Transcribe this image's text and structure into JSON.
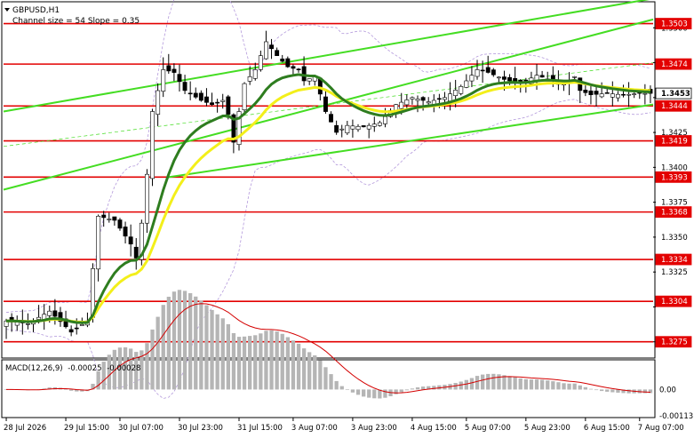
{
  "header": {
    "symbol": "GBPUSD,H1",
    "channel_info": "Channel size = 54 Slope = 0.35"
  },
  "chart_data": {
    "type": "candlestick",
    "symbol": "GBPUSD",
    "timeframe": "H1",
    "ylim": [
      1.3264,
      1.3518
    ],
    "current_price": 1.3453,
    "price_ticks": [
      1.3275,
      1.33,
      1.3325,
      1.335,
      1.3375,
      1.34,
      1.3425,
      1.345,
      1.3475,
      1.35
    ],
    "level_labels": [
      "1.3503",
      "1.3474",
      "1.3453",
      "1.3444",
      "1.3419",
      "1.3393",
      "1.3368",
      "1.3334",
      "1.3304",
      "1.3275"
    ],
    "hidden_tick_labels": [
      "1.3475",
      "1.3450",
      "1.3300",
      "1.3275"
    ],
    "time_labels": [
      "28 Jul 2026",
      "29 Jul 15:00",
      "30 Jul 07:00",
      "30 Jul 23:00",
      "31 Jul 15:00",
      "3 Aug 07:00",
      "3 Aug 23:00",
      "4 Aug 15:00",
      "5 Aug 07:00",
      "5 Aug 23:00",
      "6 Aug 15:00",
      "7 Aug 07:00"
    ],
    "levels": [
      1.3503,
      1.3474,
      1.3444,
      1.3419,
      1.3393,
      1.3368,
      1.3334,
      1.3304,
      1.3275
    ],
    "bars": 120,
    "close_path": [
      [
        0,
        1.329
      ],
      [
        4,
        1.3288
      ],
      [
        8,
        1.3297
      ],
      [
        12,
        1.3282
      ],
      [
        15,
        1.329
      ],
      [
        17,
        1.3365
      ],
      [
        20,
        1.3362
      ],
      [
        23,
        1.3345
      ],
      [
        24,
        1.3335
      ],
      [
        25,
        1.336
      ],
      [
        26,
        1.3395
      ],
      [
        27,
        1.344
      ],
      [
        29,
        1.347
      ],
      [
        31,
        1.3468
      ],
      [
        33,
        1.3455
      ],
      [
        36,
        1.3448
      ],
      [
        38,
        1.3445
      ],
      [
        40,
        1.3448
      ],
      [
        41,
        1.3438
      ],
      [
        42,
        1.3418
      ],
      [
        43,
        1.344
      ],
      [
        44,
        1.346
      ],
      [
        46,
        1.347
      ],
      [
        48,
        1.349
      ],
      [
        50,
        1.348
      ],
      [
        52,
        1.3472
      ],
      [
        54,
        1.347
      ],
      [
        55,
        1.3462
      ],
      [
        57,
        1.3465
      ],
      [
        59,
        1.344
      ],
      [
        61,
        1.3425
      ],
      [
        63,
        1.343
      ],
      [
        66,
        1.3429
      ],
      [
        69,
        1.3432
      ],
      [
        72,
        1.3445
      ],
      [
        75,
        1.345
      ],
      [
        78,
        1.3447
      ],
      [
        81,
        1.345
      ],
      [
        84,
        1.3458
      ],
      [
        87,
        1.347
      ],
      [
        89,
        1.3468
      ],
      [
        92,
        1.3463
      ],
      [
        95,
        1.346
      ],
      [
        98,
        1.3466
      ],
      [
        101,
        1.3462
      ],
      [
        103,
        1.346
      ],
      [
        105,
        1.3465
      ],
      [
        106,
        1.3455
      ],
      [
        108,
        1.3452
      ],
      [
        111,
        1.3453
      ],
      [
        114,
        1.3452
      ],
      [
        117,
        1.3453
      ],
      [
        119,
        1.3453
      ]
    ],
    "candle_colors": {
      "bull": "#000000",
      "bear": "#000000",
      "bull_fill": "#ffffff"
    },
    "moving_averages": [
      {
        "color": "#2e7d1f",
        "period": 30
      },
      {
        "color": "#f3ef1a",
        "period": 50
      }
    ],
    "envelope_color": "#b49adc",
    "channel_color": "#44dd22",
    "level_color": "#e30000",
    "grid": false,
    "macd": {
      "title": "MACD(12,26,9)",
      "macd_value": "-0.00025",
      "signal_value": "-0.00028",
      "params": [
        12,
        26,
        9
      ],
      "ticks": [
        "0.00",
        "-0.00113"
      ],
      "ylim": [
        -0.00113,
        0.0012
      ],
      "histogram_color": "#b5b5b5",
      "signal_color": "#d40000"
    }
  }
}
